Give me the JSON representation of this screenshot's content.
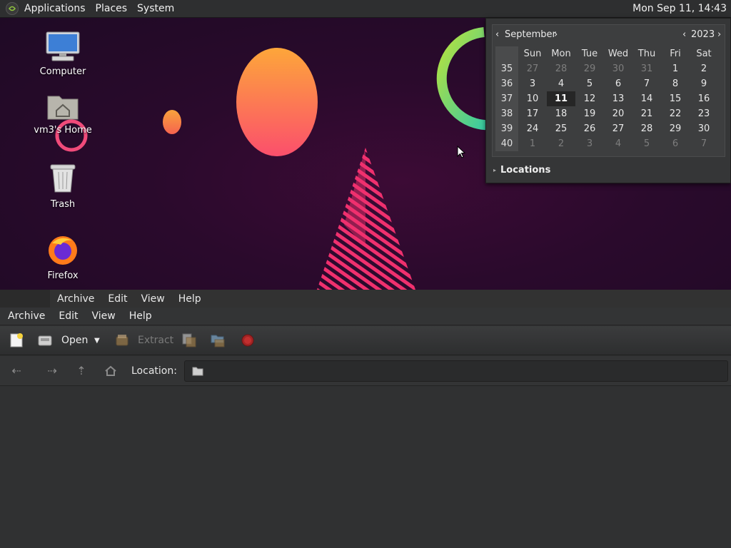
{
  "panel": {
    "menus": [
      "Applications",
      "Places",
      "System"
    ],
    "clock": "Mon Sep 11, 14:43"
  },
  "desktop": {
    "icons": [
      {
        "label": "Computer",
        "icon": "computer-icon"
      },
      {
        "label": "vm3's Home",
        "icon": "home-folder-icon"
      },
      {
        "label": "Trash",
        "icon": "trash-icon"
      },
      {
        "label": "Firefox",
        "icon": "firefox-icon"
      }
    ]
  },
  "calendar": {
    "month": "September",
    "year": "2023",
    "weekdays": [
      "Sun",
      "Mon",
      "Tue",
      "Wed",
      "Thu",
      "Fri",
      "Sat"
    ],
    "weeks": [
      {
        "week": "35",
        "days": [
          "27",
          "28",
          "29",
          "30",
          "31",
          "1",
          "2"
        ],
        "dim": [
          true,
          true,
          true,
          true,
          true,
          false,
          false
        ]
      },
      {
        "week": "36",
        "days": [
          "3",
          "4",
          "5",
          "6",
          "7",
          "8",
          "9"
        ],
        "dim": [
          false,
          false,
          false,
          false,
          false,
          false,
          false
        ]
      },
      {
        "week": "37",
        "days": [
          "10",
          "11",
          "12",
          "13",
          "14",
          "15",
          "16"
        ],
        "dim": [
          false,
          false,
          false,
          false,
          false,
          false,
          false
        ]
      },
      {
        "week": "38",
        "days": [
          "17",
          "18",
          "19",
          "20",
          "21",
          "22",
          "23"
        ],
        "dim": [
          false,
          false,
          false,
          false,
          false,
          false,
          false
        ]
      },
      {
        "week": "39",
        "days": [
          "24",
          "25",
          "26",
          "27",
          "28",
          "29",
          "30"
        ],
        "dim": [
          false,
          false,
          false,
          false,
          false,
          false,
          false
        ]
      },
      {
        "week": "40",
        "days": [
          "1",
          "2",
          "3",
          "4",
          "5",
          "6",
          "7"
        ],
        "dim": [
          true,
          true,
          true,
          true,
          true,
          true,
          true
        ]
      }
    ],
    "today": "11",
    "locations_label": "Locations"
  },
  "ghost_menubar": [
    "Archive",
    "Edit",
    "View",
    "Help"
  ],
  "archive": {
    "menubar": [
      "Archive",
      "Edit",
      "View",
      "Help"
    ],
    "toolbar": {
      "open_label": "Open",
      "extract_label": "Extract"
    },
    "location_label": "Location:"
  }
}
